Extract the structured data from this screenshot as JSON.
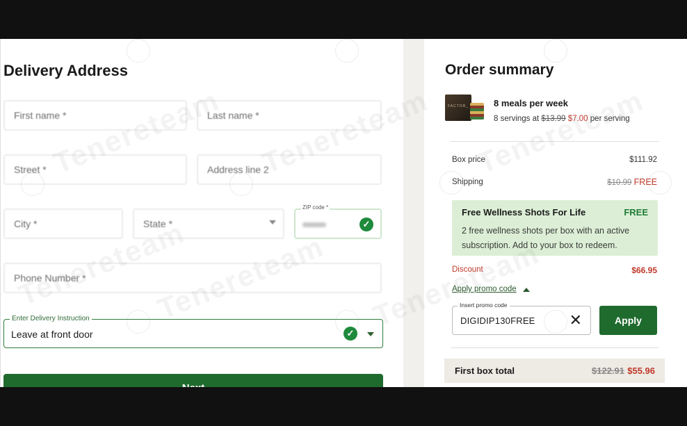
{
  "delivery": {
    "title": "Delivery Address",
    "first_name": "First name *",
    "last_name": "Last name *",
    "street": "Street *",
    "address_line2": "Address line 2",
    "city": "City *",
    "state": "State *",
    "zip_label": "ZIP code *",
    "phone": "Phone Number *",
    "instruction_label": "Enter Delivery Instruction",
    "instruction_value": "Leave at front door",
    "next_button": "Next"
  },
  "summary": {
    "title": "Order summary",
    "product_title": "8 meals per week",
    "servings_text": "8 servings at",
    "old_price_per_serving": "$13.99",
    "new_price_per_serving": "$7.00",
    "per_serving": "per serving",
    "product_box_text": "FACTOR_",
    "box_price_label": "Box price",
    "box_price_value": "$111.92",
    "shipping_label": "Shipping",
    "shipping_old": "$10.99",
    "shipping_new": "FREE",
    "promo_title": "Free Wellness Shots For Life",
    "promo_free": "FREE",
    "promo_desc": "2 free wellness shots per box with an active subscription. Add to your box to redeem.",
    "discount_label": "Discount",
    "discount_value": "$66.95",
    "apply_promo_link": "Apply promo code",
    "promo_input_label": "Insert promo code",
    "promo_input_value": "DIGIDIP130FREE",
    "apply_button": "Apply",
    "total_label": "First box total",
    "total_old": "$122.91",
    "total_new": "$55.96"
  },
  "watermark": "Tenereteam",
  "colors": {
    "accent_green": "#1f6b2d",
    "promo_bg": "#dcefd6",
    "discount_red": "#c0392b"
  }
}
